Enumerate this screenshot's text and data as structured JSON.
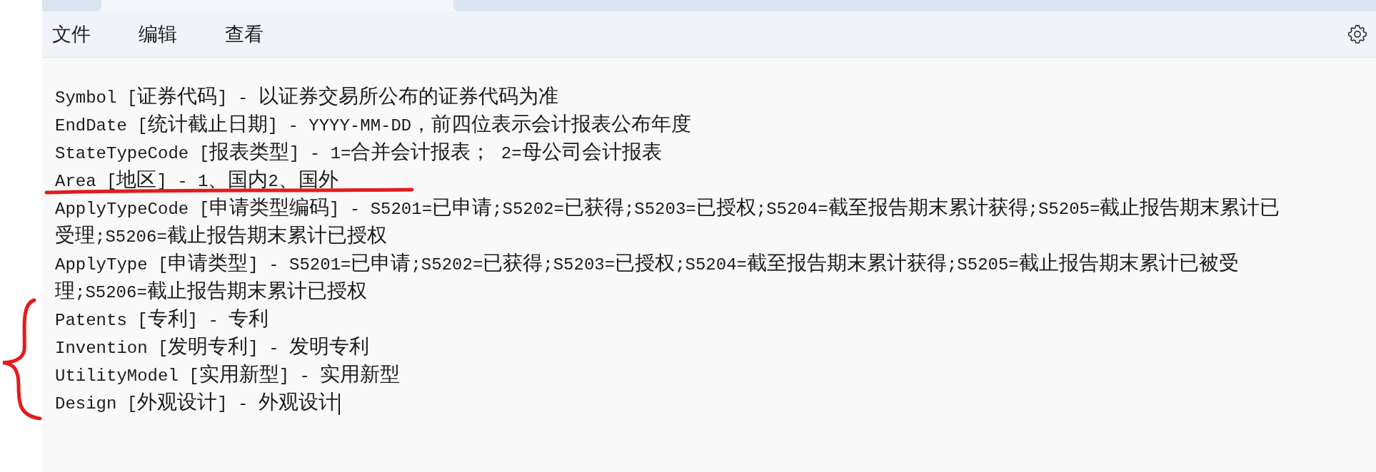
{
  "menu": [
    {
      "label": "文件"
    },
    {
      "label": "编辑"
    },
    {
      "label": "查看"
    }
  ],
  "lines": [
    {
      "text": "Symbol [证券代码] - 以证券交易所公布的证券代码为准",
      "underlined": false,
      "braced": false,
      "caret": false
    },
    {
      "text": "EndDate [统计截止日期] - YYYY-MM-DD，前四位表示会计报表公布年度",
      "underlined": false,
      "braced": false,
      "caret": false
    },
    {
      "text": "StateTypeCode [报表类型] - 1=合并会计报表； 2=母公司会计报表",
      "underlined": false,
      "braced": false,
      "caret": false
    },
    {
      "text": "Area [地区] - 1、国内2、国外",
      "underlined": true,
      "braced": false,
      "caret": false
    },
    {
      "text": "ApplyTypeCode [申请类型编码] - S5201=已申请;S5202=已获得;S5203=已授权;S5204=截至报告期末累计获得;S5205=截止报告期末累计已",
      "underlined": false,
      "braced": false,
      "caret": false
    },
    {
      "text": "受理;S5206=截止报告期末累计已授权",
      "underlined": false,
      "braced": false,
      "caret": false
    },
    {
      "text": "ApplyType [申请类型] - S5201=已申请;S5202=已获得;S5203=已授权;S5204=截至报告期末累计获得;S5205=截止报告期末累计已被受",
      "underlined": false,
      "braced": false,
      "caret": false
    },
    {
      "text": "理;S5206=截止报告期末累计已授权",
      "underlined": false,
      "braced": false,
      "caret": false
    },
    {
      "text": "Patents [专利] - 专利",
      "underlined": false,
      "braced": true,
      "caret": false
    },
    {
      "text": "Invention [发明专利] - 发明专利",
      "underlined": false,
      "braced": true,
      "caret": false
    },
    {
      "text": "UtilityModel [实用新型] - 实用新型",
      "underlined": false,
      "braced": true,
      "caret": false
    },
    {
      "text": "Design [外观设计] - 外观设计",
      "underlined": false,
      "braced": true,
      "caret": true
    }
  ]
}
